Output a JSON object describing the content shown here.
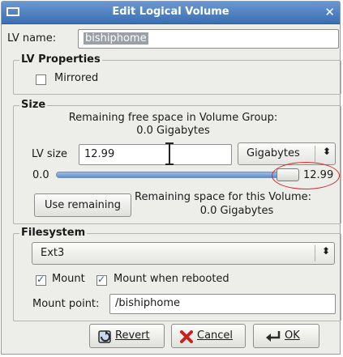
{
  "window": {
    "title": "Edit Logical Volume",
    "close_glyph": "✕"
  },
  "lv_name": {
    "label": "LV name:",
    "value": "bishiphome"
  },
  "lv_properties": {
    "title": "LV Properties",
    "mirrored_label": "Mirrored",
    "mirrored_checked": false
  },
  "size": {
    "title": "Size",
    "remaining_free_text": "Remaining free space in Volume Group:",
    "remaining_free_value": "0.0 Gigabytes",
    "lv_size_label": "LV size",
    "lv_size_value": "12.99",
    "unit": "Gigabytes",
    "slider_min": "0.0",
    "slider_max": "12.99",
    "slider_fraction": 1.0,
    "use_remaining_label": "Use remaining",
    "remaining_volume_text": "Remaining space for this Volume:",
    "remaining_volume_value": "0.0 Gigabytes"
  },
  "filesystem": {
    "title": "Filesystem",
    "type": "Ext3",
    "mount_label": "Mount",
    "mount_checked": true,
    "mount_rebooted_label": "Mount when rebooted",
    "mount_rebooted_checked": true,
    "mount_point_label": "Mount point:",
    "mount_point_value": "/bishiphome"
  },
  "buttons": {
    "revert": "Revert",
    "cancel": "Cancel",
    "ok": "OK"
  },
  "icons": {
    "revert": "revert-icon",
    "cancel": "cancel-x-icon",
    "ok": "ok-icon",
    "combo": "combo-arrows-icon"
  },
  "colors": {
    "titlebar": "#3b6fb3",
    "annotation_circle": "#d0282a",
    "slider_fill": "#5d8fcf"
  }
}
